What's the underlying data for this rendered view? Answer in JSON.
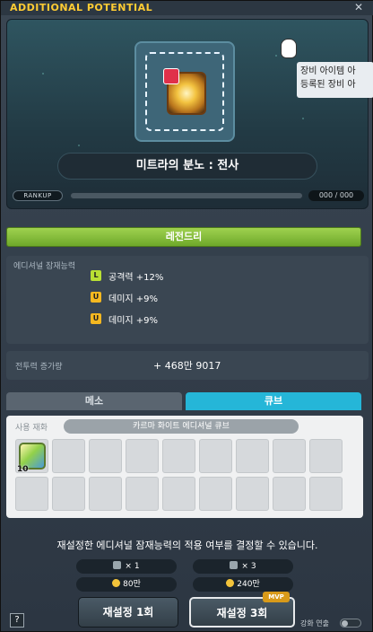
{
  "window": {
    "title": "ADDITIONAL POTENTIAL",
    "close_icon": "close-icon"
  },
  "item": {
    "name": "미트라의 분노 : 전사",
    "icon": "emblem-icon"
  },
  "rankup": {
    "label": "RANKUP",
    "count": "000 / 000"
  },
  "tooltip": {
    "line1": "장비 아이템 아",
    "line2": "등록된 장비 아"
  },
  "grade": {
    "label": "레전드리",
    "color": "#8dc63f"
  },
  "options": {
    "title": "에디셔널 잠재능력",
    "lines": [
      {
        "grade": "L",
        "text": "공격력 +12%"
      },
      {
        "grade": "U",
        "text": "데미지 +9%"
      },
      {
        "grade": "U",
        "text": "데미지 +9%"
      }
    ]
  },
  "power": {
    "label": "전투력 증가량",
    "value": "+ 468만 9017"
  },
  "tabs": [
    {
      "label": "메소",
      "active": false
    },
    {
      "label": "큐브",
      "active": true
    }
  ],
  "materials": {
    "title": "사용 재화",
    "name": "카르마 화이트 에디셔널 큐브",
    "cube_count": "10"
  },
  "hint": "재설정한 에디셔널 잠재능력의 적용 여부를 결정할 수 있습니다.",
  "costs": [
    {
      "cubes": "× 1",
      "meso": "80만"
    },
    {
      "cubes": "× 3",
      "meso": "240만"
    }
  ],
  "buttons": {
    "reset1": "재설정 1회",
    "reset3": "재설정 3회",
    "mvp": "MVP"
  },
  "help": "?",
  "enhance_toggle": "강화 연출"
}
